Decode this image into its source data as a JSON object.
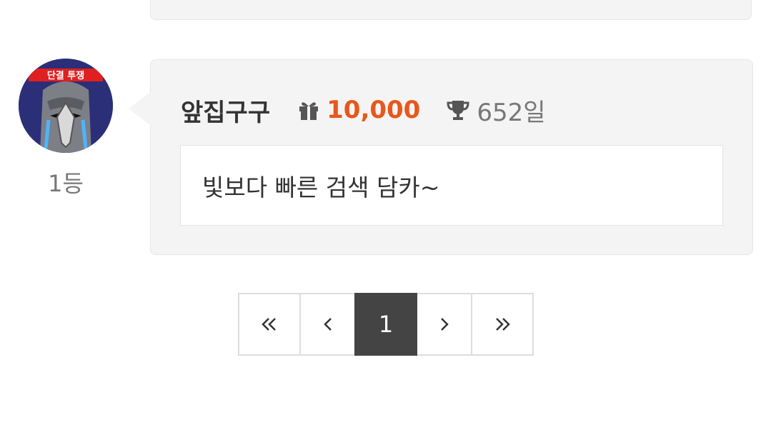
{
  "comment": {
    "rank": "1등",
    "nickname": "앞집구구",
    "points": "10,000",
    "days": "652일",
    "text": "빛보다 빠른 검색 담카~",
    "icons": {
      "points": "gift-icon",
      "days": "trophy-icon"
    },
    "avatar_banner_text": "단결 투쟁"
  },
  "pagination": {
    "first": "first-page-icon",
    "prev": "prev-page-icon",
    "current_page": "1",
    "next": "next-page-icon",
    "last": "last-page-icon"
  },
  "colors": {
    "points": "#e8571b",
    "active_page_bg": "#444444",
    "card_bg": "#f4f4f4",
    "muted_text": "#777777"
  }
}
